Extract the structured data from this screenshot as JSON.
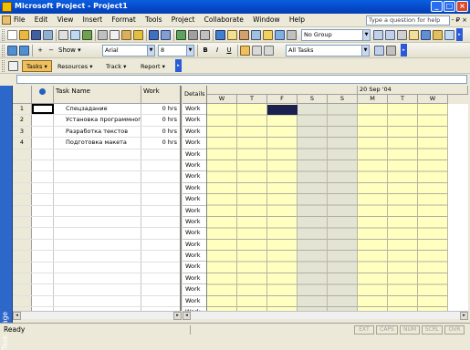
{
  "window": {
    "title": "Microsoft Project - Project1"
  },
  "menu": {
    "items": [
      "File",
      "Edit",
      "View",
      "Insert",
      "Format",
      "Tools",
      "Project",
      "Collaborate",
      "Window",
      "Help"
    ],
    "help_placeholder": "Type a question for help",
    "mdi_controls": "- ₽ ×"
  },
  "toolbar_standard": {
    "group_combo": "No Group"
  },
  "toolbar_formatting": {
    "indent_label": "Show",
    "font": "Arial",
    "font_size": "8",
    "bold": "B",
    "italic": "I",
    "underline": "U",
    "filter": "All Tasks"
  },
  "project_guide": {
    "tasks": "Tasks",
    "resources": "Resources",
    "track": "Track",
    "report": "Report"
  },
  "view_bar": {
    "label": "Task Usage"
  },
  "table": {
    "columns": {
      "task_name": "Task Name",
      "work": "Work"
    },
    "rows": [
      {
        "id": "1",
        "name": "Спецзадание",
        "work": "0 hrs"
      },
      {
        "id": "2",
        "name": "Установка программного",
        "work": "0 hrs"
      },
      {
        "id": "3",
        "name": "Разработка текстов",
        "work": "0 hrs"
      },
      {
        "id": "4",
        "name": "Подготовка макета",
        "work": "0 hrs"
      }
    ]
  },
  "timephased": {
    "details_header": "Details",
    "week_label": "20 Sep '04",
    "days": [
      "W",
      "T",
      "F",
      "S",
      "S",
      "M",
      "T",
      "W"
    ],
    "row_label": "Work"
  },
  "status": {
    "text": "Ready",
    "indicators": [
      "EXT",
      "CAPS",
      "NUM",
      "SCRL",
      "OVR"
    ]
  }
}
